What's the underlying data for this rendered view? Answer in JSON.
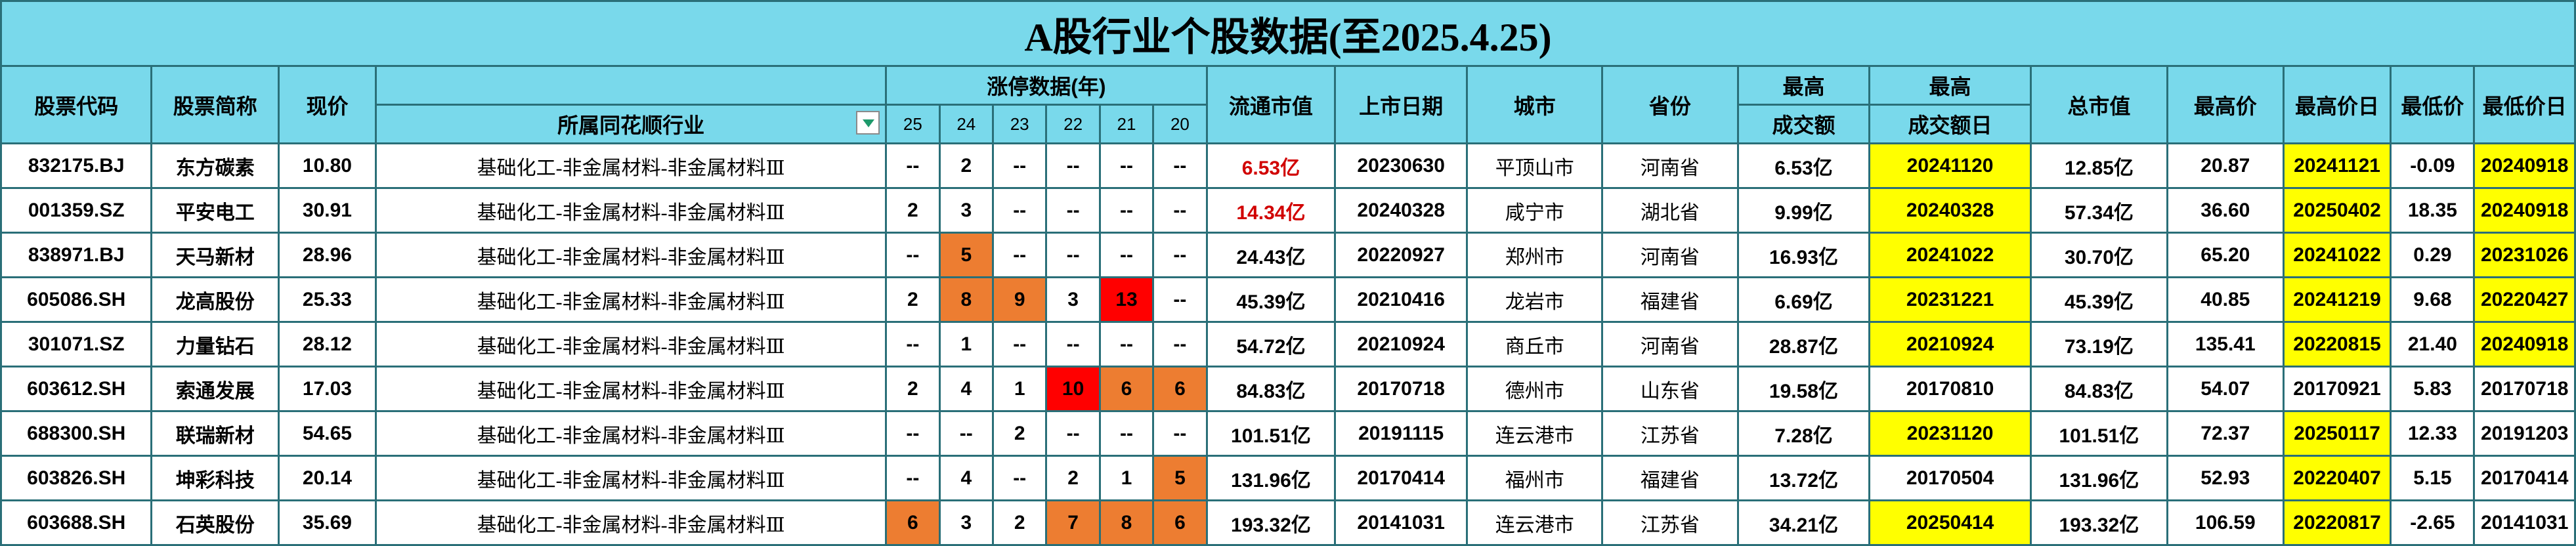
{
  "title": "A股行业个股数据(至2025.4.25)",
  "headers": {
    "code": "股票代码",
    "name": "股票简称",
    "price": "现价",
    "industry": "所属同花顺行业",
    "limit_up": "涨停数据(年)",
    "years": [
      "25",
      "24",
      "23",
      "22",
      "21",
      "20"
    ],
    "float_cap": "流通市值",
    "listing_date": "上市日期",
    "city": "城市",
    "province": "省份",
    "max_turnover_1": "最高",
    "max_turnover_2": "成交额",
    "max_turnover_day_1": "最高",
    "max_turnover_day_2": "成交额日",
    "total_cap": "总市值",
    "high_price": "最高价",
    "high_price_day": "最高价日",
    "low_price": "最低价",
    "low_price_day": "最低价日"
  },
  "colors": {
    "header_bg": "#79d9eb",
    "border": "#2a6f78",
    "highlight_yellow": "#ffff00",
    "highlight_orange": "#ed7d31",
    "highlight_red": "#ff0000",
    "text_red": "#d10000",
    "dropdown_arrow": "#1e9a6b"
  },
  "rows": [
    {
      "code": "832175.BJ",
      "name": "东方碳素",
      "price": "10.80",
      "industry": "基础化工-非金属材料-非金属材料Ⅲ",
      "y25": "--",
      "y24": "2",
      "y23": "--",
      "y22": "--",
      "y21": "--",
      "y20": "--",
      "float_cap": "6.53亿",
      "listing_date": "20230630",
      "city": "平顶山市",
      "province": "河南省",
      "max_turnover": "6.53亿",
      "max_turnover_day": "20241120",
      "total_cap": "12.85亿",
      "high_price": "20.87",
      "high_price_day": "20241121",
      "low_price": "-0.09",
      "low_price_day": "20240918"
    },
    {
      "code": "001359.SZ",
      "name": "平安电工",
      "price": "30.91",
      "industry": "基础化工-非金属材料-非金属材料Ⅲ",
      "y25": "2",
      "y24": "3",
      "y23": "--",
      "y22": "--",
      "y21": "--",
      "y20": "--",
      "float_cap": "14.34亿",
      "listing_date": "20240328",
      "city": "咸宁市",
      "province": "湖北省",
      "max_turnover": "9.99亿",
      "max_turnover_day": "20240328",
      "total_cap": "57.34亿",
      "high_price": "36.60",
      "high_price_day": "20250402",
      "low_price": "18.35",
      "low_price_day": "20240918"
    },
    {
      "code": "838971.BJ",
      "name": "天马新材",
      "price": "28.96",
      "industry": "基础化工-非金属材料-非金属材料Ⅲ",
      "y25": "--",
      "y24": "5",
      "y23": "--",
      "y22": "--",
      "y21": "--",
      "y20": "--",
      "float_cap": "24.43亿",
      "listing_date": "20220927",
      "city": "郑州市",
      "province": "河南省",
      "max_turnover": "16.93亿",
      "max_turnover_day": "20241022",
      "total_cap": "30.70亿",
      "high_price": "65.20",
      "high_price_day": "20241022",
      "low_price": "0.29",
      "low_price_day": "20231026"
    },
    {
      "code": "605086.SH",
      "name": "龙高股份",
      "price": "25.33",
      "industry": "基础化工-非金属材料-非金属材料Ⅲ",
      "y25": "2",
      "y24": "8",
      "y23": "9",
      "y22": "3",
      "y21": "13",
      "y20": "--",
      "float_cap": "45.39亿",
      "listing_date": "20210416",
      "city": "龙岩市",
      "province": "福建省",
      "max_turnover": "6.69亿",
      "max_turnover_day": "20231221",
      "total_cap": "45.39亿",
      "high_price": "40.85",
      "high_price_day": "20241219",
      "low_price": "9.68",
      "low_price_day": "20220427"
    },
    {
      "code": "301071.SZ",
      "name": "力量钻石",
      "price": "28.12",
      "industry": "基础化工-非金属材料-非金属材料Ⅲ",
      "y25": "--",
      "y24": "1",
      "y23": "--",
      "y22": "--",
      "y21": "--",
      "y20": "--",
      "float_cap": "54.72亿",
      "listing_date": "20210924",
      "city": "商丘市",
      "province": "河南省",
      "max_turnover": "28.87亿",
      "max_turnover_day": "20210924",
      "total_cap": "73.19亿",
      "high_price": "135.41",
      "high_price_day": "20220815",
      "low_price": "21.40",
      "low_price_day": "20240918"
    },
    {
      "code": "603612.SH",
      "name": "索通发展",
      "price": "17.03",
      "industry": "基础化工-非金属材料-非金属材料Ⅲ",
      "y25": "2",
      "y24": "4",
      "y23": "1",
      "y22": "10",
      "y21": "6",
      "y20": "6",
      "float_cap": "84.83亿",
      "listing_date": "20170718",
      "city": "德州市",
      "province": "山东省",
      "max_turnover": "19.58亿",
      "max_turnover_day": "20170810",
      "total_cap": "84.83亿",
      "high_price": "54.07",
      "high_price_day": "20170921",
      "low_price": "5.83",
      "low_price_day": "20170718"
    },
    {
      "code": "688300.SH",
      "name": "联瑞新材",
      "price": "54.65",
      "industry": "基础化工-非金属材料-非金属材料Ⅲ",
      "y25": "--",
      "y24": "--",
      "y23": "2",
      "y22": "--",
      "y21": "--",
      "y20": "--",
      "float_cap": "101.51亿",
      "listing_date": "20191115",
      "city": "连云港市",
      "province": "江苏省",
      "max_turnover": "7.28亿",
      "max_turnover_day": "20231120",
      "total_cap": "101.51亿",
      "high_price": "72.37",
      "high_price_day": "20250117",
      "low_price": "12.33",
      "low_price_day": "20191203"
    },
    {
      "code": "603826.SH",
      "name": "坤彩科技",
      "price": "20.14",
      "industry": "基础化工-非金属材料-非金属材料Ⅲ",
      "y25": "--",
      "y24": "4",
      "y23": "--",
      "y22": "2",
      "y21": "1",
      "y20": "5",
      "float_cap": "131.96亿",
      "listing_date": "20170414",
      "city": "福州市",
      "province": "福建省",
      "max_turnover": "13.72亿",
      "max_turnover_day": "20170504",
      "total_cap": "131.96亿",
      "high_price": "52.93",
      "high_price_day": "20220407",
      "low_price": "5.15",
      "low_price_day": "20170414"
    },
    {
      "code": "603688.SH",
      "name": "石英股份",
      "price": "35.69",
      "industry": "基础化工-非金属材料-非金属材料Ⅲ",
      "y25": "6",
      "y24": "3",
      "y23": "2",
      "y22": "7",
      "y21": "8",
      "y20": "6",
      "float_cap": "193.32亿",
      "listing_date": "20141031",
      "city": "连云港市",
      "province": "江苏省",
      "max_turnover": "34.21亿",
      "max_turnover_day": "20250414",
      "total_cap": "193.32亿",
      "high_price": "106.59",
      "high_price_day": "20220817",
      "low_price": "-2.65",
      "low_price_day": "20141031"
    }
  ]
}
